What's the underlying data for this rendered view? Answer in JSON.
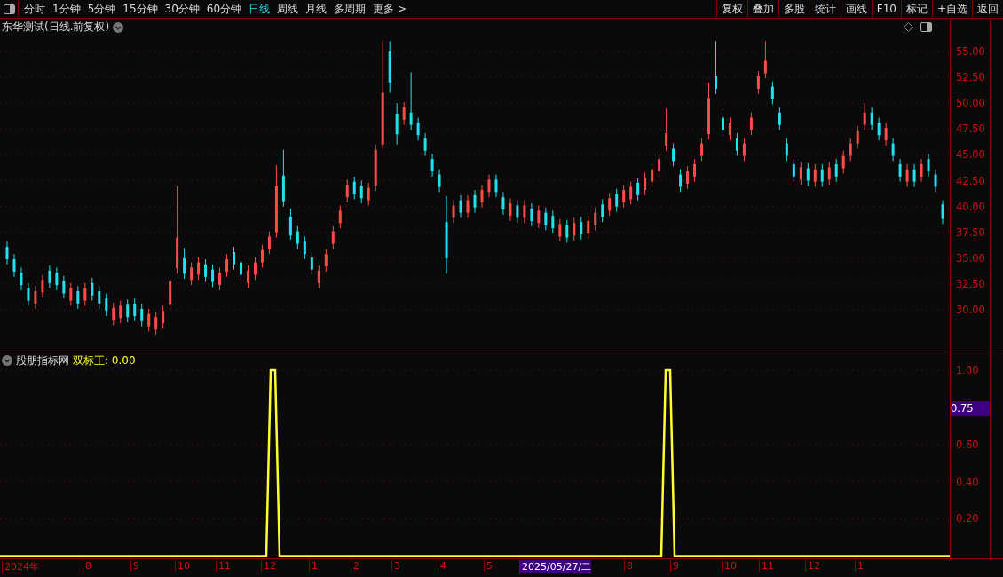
{
  "toolbar": {
    "periods": [
      {
        "label": "分时",
        "selected": false
      },
      {
        "label": "1分钟",
        "selected": false
      },
      {
        "label": "5分钟",
        "selected": false
      },
      {
        "label": "15分钟",
        "selected": false
      },
      {
        "label": "30分钟",
        "selected": false
      },
      {
        "label": "60分钟",
        "selected": false
      },
      {
        "label": "日线",
        "selected": true
      },
      {
        "label": "周线",
        "selected": false
      },
      {
        "label": "月线",
        "selected": false
      },
      {
        "label": "多周期",
        "selected": false
      },
      {
        "label": "更多 >",
        "selected": false
      }
    ],
    "actions": [
      "复权",
      "叠加",
      "多股",
      "统计",
      "画线",
      "F10",
      "标记",
      "+自选",
      "返回"
    ]
  },
  "chart": {
    "title": "东华测试(日线.前复权)",
    "chart_data": {
      "type": "candlestick",
      "grid": true,
      "ylim": [
        25.88,
        58.18
      ],
      "categories": [
        null,
        null,
        null,
        null,
        null,
        null,
        null,
        null,
        null,
        null,
        null,
        null,
        null,
        null,
        null,
        null,
        null,
        null,
        null,
        null,
        null,
        null,
        null,
        null,
        null,
        null,
        null,
        null,
        null,
        null,
        null,
        null,
        null,
        null,
        null,
        null,
        null,
        null,
        null,
        null,
        null,
        null,
        null,
        null,
        null,
        null,
        null,
        null,
        null,
        null,
        null,
        null,
        null,
        null,
        null,
        null,
        null,
        null,
        null,
        null,
        null,
        null,
        null,
        null,
        null,
        null,
        null,
        null,
        null,
        null,
        null,
        null,
        null,
        null,
        null,
        null,
        null,
        null,
        null,
        null,
        null,
        null,
        null,
        null,
        null,
        null,
        null,
        null,
        null,
        null,
        null,
        null,
        null,
        null,
        null,
        null,
        null,
        null,
        null,
        null,
        null,
        null,
        null,
        null,
        null,
        null,
        null,
        null,
        null,
        null,
        null,
        null,
        null,
        null,
        null,
        null,
        null,
        null,
        null,
        null,
        null,
        null,
        null,
        null,
        null,
        null,
        null,
        null,
        null,
        null,
        null,
        null,
        null
      ],
      "ohlc": [
        [
          36.1,
          36.6,
          34.4,
          34.9
        ],
        [
          34.9,
          35.4,
          33.2,
          33.7
        ],
        [
          33.6,
          34.1,
          31.9,
          32.4
        ],
        [
          32.1,
          32.6,
          30.4,
          30.9
        ],
        [
          30.6,
          32.3,
          30.1,
          31.8
        ],
        [
          31.7,
          33.4,
          31.2,
          32.9
        ],
        [
          33.8,
          34.3,
          32.1,
          32.6
        ],
        [
          33.6,
          34.1,
          31.9,
          32.4
        ],
        [
          32.8,
          33.3,
          31.1,
          31.6
        ],
        [
          30.9,
          32.6,
          30.4,
          32.1
        ],
        [
          31.8,
          32.3,
          30.1,
          30.6
        ],
        [
          30.9,
          32.6,
          30.4,
          32.1
        ],
        [
          32.6,
          33.1,
          30.9,
          31.4
        ],
        [
          31.8,
          32.3,
          30.1,
          30.6
        ],
        [
          31.1,
          31.6,
          29.4,
          29.9
        ],
        [
          29,
          30.7,
          28.5,
          30.2
        ],
        [
          29.2,
          30.9,
          28.7,
          30.4
        ],
        [
          30.5,
          31,
          28.8,
          29.3
        ],
        [
          30.6,
          31.1,
          28.9,
          29.4
        ],
        [
          30.1,
          30.6,
          28.4,
          28.9
        ],
        [
          28.4,
          30.1,
          27.9,
          29.6
        ],
        [
          28.1,
          29.8,
          27.6,
          29.3
        ],
        [
          28.7,
          30.4,
          28.2,
          29.9
        ],
        [
          30.5,
          33,
          30,
          32.8
        ],
        [
          34,
          42,
          33.5,
          37
        ],
        [
          35,
          36,
          33,
          33.5
        ],
        [
          32.9,
          34.6,
          32.4,
          34.1
        ],
        [
          33.4,
          35.1,
          32.9,
          34.6
        ],
        [
          34.4,
          34.9,
          32.7,
          33.2
        ],
        [
          33.9,
          34.4,
          32.2,
          32.7
        ],
        [
          32.4,
          34.1,
          31.9,
          33.6
        ],
        [
          33.7,
          35.4,
          33.2,
          34.9
        ],
        [
          35.6,
          36.1,
          33.9,
          34.4
        ],
        [
          34.6,
          35.1,
          32.9,
          33.4
        ],
        [
          32.6,
          34.3,
          32.1,
          33.8
        ],
        [
          33.4,
          35.1,
          32.9,
          34.6
        ],
        [
          34.6,
          36.3,
          34.1,
          35.8
        ],
        [
          35.9,
          37.6,
          35.4,
          37.1
        ],
        [
          37.5,
          44,
          37,
          42
        ],
        [
          43,
          45.5,
          40,
          40.5
        ],
        [
          39,
          39.8,
          36.8,
          37.2
        ],
        [
          37.6,
          38.1,
          35.9,
          36.4
        ],
        [
          36.6,
          37.1,
          34.9,
          35.4
        ],
        [
          35.1,
          35.6,
          33.4,
          33.9
        ],
        [
          32.6,
          34.3,
          32.1,
          33.8
        ],
        [
          34.2,
          35.9,
          33.7,
          35.4
        ],
        [
          36.4,
          38.1,
          35.9,
          37.6
        ],
        [
          38.4,
          40.1,
          37.9,
          39.6
        ],
        [
          40.9,
          42.6,
          40.4,
          42.1
        ],
        [
          42.4,
          42.9,
          40.7,
          41.2
        ],
        [
          42,
          42.5,
          40.3,
          40.8
        ],
        [
          40.6,
          42.3,
          40.1,
          41.8
        ],
        [
          42,
          46,
          41.5,
          45.5
        ],
        [
          46,
          56,
          45.5,
          51
        ],
        [
          55,
          56,
          51,
          52
        ],
        [
          49,
          50,
          46,
          47
        ],
        [
          48.4,
          50.1,
          47.9,
          49.6
        ],
        [
          49.1,
          53,
          47.4,
          47.9
        ],
        [
          48.1,
          48.6,
          46.4,
          46.9
        ],
        [
          46.6,
          47.1,
          44.9,
          45.4
        ],
        [
          44.6,
          45.1,
          42.9,
          43.4
        ],
        [
          43.1,
          43.6,
          41.4,
          41.9
        ],
        [
          38.5,
          41,
          33.5,
          35
        ],
        [
          38.9,
          40.6,
          38.4,
          40.1
        ],
        [
          40.6,
          41.1,
          38.9,
          39.4
        ],
        [
          39.4,
          41.1,
          38.9,
          40.6
        ],
        [
          41.1,
          41.6,
          39.4,
          39.9
        ],
        [
          40.4,
          42.1,
          39.9,
          41.6
        ],
        [
          41.4,
          43.1,
          40.9,
          42.6
        ],
        [
          42.6,
          43.1,
          40.9,
          41.4
        ],
        [
          40.9,
          41.4,
          39.2,
          39.7
        ],
        [
          39.1,
          40.8,
          38.6,
          40.3
        ],
        [
          40.1,
          40.6,
          38.4,
          38.9
        ],
        [
          38.9,
          40.6,
          38.4,
          40.1
        ],
        [
          39.8,
          40.3,
          38.1,
          38.6
        ],
        [
          38.4,
          40.1,
          37.9,
          39.6
        ],
        [
          39.4,
          39.9,
          37.7,
          38.2
        ],
        [
          39.1,
          39.6,
          37.4,
          37.9
        ],
        [
          37.1,
          38.8,
          36.6,
          38.3
        ],
        [
          38.2,
          38.7,
          36.5,
          37
        ],
        [
          37.2,
          38.9,
          36.7,
          38.4
        ],
        [
          38.5,
          39,
          36.8,
          37.3
        ],
        [
          37.4,
          39.1,
          36.9,
          38.6
        ],
        [
          38.2,
          39.9,
          37.7,
          39.4
        ],
        [
          40.2,
          40.7,
          38.5,
          39
        ],
        [
          39.6,
          41.3,
          39.1,
          40.8
        ],
        [
          41.2,
          41.7,
          39.5,
          40
        ],
        [
          40.4,
          42.1,
          39.9,
          41.6
        ],
        [
          40.7,
          42.4,
          40.2,
          41.9
        ],
        [
          42.3,
          42.8,
          40.6,
          41.1
        ],
        [
          41.6,
          43.3,
          41.1,
          42.8
        ],
        [
          42.4,
          44.1,
          41.9,
          43.6
        ],
        [
          43.4,
          45.1,
          42.9,
          44.6
        ],
        [
          45.9,
          49.5,
          45.4,
          47.1
        ],
        [
          45.6,
          46.1,
          43.9,
          44.4
        ],
        [
          43.1,
          43.6,
          41.4,
          41.9
        ],
        [
          42.2,
          43.9,
          41.7,
          43.4
        ],
        [
          42.9,
          44.6,
          42.4,
          44.1
        ],
        [
          44.9,
          46.6,
          44.4,
          46.1
        ],
        [
          47,
          52,
          46.5,
          50.5
        ],
        [
          52.6,
          56,
          50.9,
          51.4
        ],
        [
          48.6,
          49.1,
          46.9,
          47.4
        ],
        [
          46.9,
          48.6,
          46.4,
          48.1
        ],
        [
          46.6,
          47.1,
          44.9,
          45.4
        ],
        [
          44.9,
          46.6,
          44.4,
          46.1
        ],
        [
          47.4,
          49.1,
          46.9,
          48.6
        ],
        [
          51.4,
          53.1,
          50.9,
          52.6
        ],
        [
          52.9,
          56,
          52.4,
          54.1
        ],
        [
          51.6,
          52.1,
          49.9,
          50.4
        ],
        [
          49.1,
          49.6,
          47.4,
          47.9
        ],
        [
          46.1,
          46.6,
          44.4,
          44.9
        ],
        [
          44.1,
          44.6,
          42.4,
          42.9
        ],
        [
          42.6,
          44.3,
          42.1,
          43.8
        ],
        [
          43.7,
          44.2,
          42,
          42.5
        ],
        [
          42.4,
          44.1,
          41.9,
          43.6
        ],
        [
          43.6,
          44.1,
          41.9,
          42.4
        ],
        [
          42.6,
          44.3,
          42.1,
          43.8
        ],
        [
          44.1,
          44.6,
          42.4,
          42.9
        ],
        [
          43.7,
          45.4,
          43.2,
          44.9
        ],
        [
          44.9,
          46.6,
          44.4,
          46.1
        ],
        [
          46.1,
          47.8,
          45.6,
          47.3
        ],
        [
          47.9,
          50,
          47.4,
          49.1
        ],
        [
          49.1,
          49.6,
          47.4,
          47.9
        ],
        [
          48.1,
          48.6,
          46.4,
          46.9
        ],
        [
          46.4,
          48.1,
          45.9,
          47.6
        ],
        [
          46.1,
          46.6,
          44.4,
          44.9
        ],
        [
          44.1,
          44.6,
          42.4,
          42.9
        ],
        [
          42.4,
          44.1,
          41.9,
          43.6
        ],
        [
          43.6,
          44.1,
          41.9,
          42.4
        ],
        [
          42.9,
          44.6,
          42.4,
          44.1
        ],
        [
          44.6,
          45.1,
          42.9,
          43.4
        ],
        [
          43.1,
          43.6,
          41.4,
          41.9
        ],
        [
          40.2,
          40.6,
          38.3,
          38.8
        ]
      ],
      "yticks": [
        {
          "value": 55,
          "label": "55.00"
        },
        {
          "value": 52.5,
          "label": "52.50"
        },
        {
          "value": 50,
          "label": "50.00"
        },
        {
          "value": 47.5,
          "label": "47.50"
        },
        {
          "value": 45,
          "label": "45.00"
        },
        {
          "value": 42.5,
          "label": "42.50"
        },
        {
          "value": 40,
          "label": "40.00"
        },
        {
          "value": 37.5,
          "label": "37.50"
        },
        {
          "value": 35,
          "label": "35.00"
        },
        {
          "value": 32.5,
          "label": "32.50"
        },
        {
          "value": 30,
          "label": "30.00"
        }
      ]
    }
  },
  "indicator": {
    "source": "股朋指标网",
    "name": "双标王:",
    "value": "0.00",
    "cursor_value": "0.75",
    "chart_data": {
      "type": "line",
      "grid": true,
      "categories": [
        null,
        null,
        null,
        null,
        null,
        null,
        null,
        null,
        null,
        null,
        null,
        null,
        null,
        null,
        null,
        null,
        null,
        null,
        null,
        null,
        null,
        null,
        null,
        null,
        null,
        null,
        null,
        null,
        null,
        null,
        null,
        null,
        null,
        null,
        null,
        null,
        null,
        null,
        null,
        null,
        null,
        null,
        null,
        null,
        null,
        null,
        null,
        null,
        null,
        null,
        null,
        null,
        null,
        null,
        null,
        null,
        null,
        null,
        null,
        null,
        null,
        null,
        null,
        null,
        null,
        null,
        null,
        null,
        null,
        null,
        null,
        null,
        null,
        null,
        null,
        null,
        null,
        null,
        null,
        null,
        null,
        null,
        null,
        null,
        null,
        null,
        null,
        null,
        null,
        null,
        null,
        null,
        null,
        null,
        null,
        null,
        null,
        null,
        null,
        null,
        null,
        null,
        null,
        null,
        null,
        null,
        null,
        null,
        null,
        null,
        null,
        null,
        null,
        null,
        null,
        null,
        null,
        null,
        null,
        null,
        null,
        null,
        null,
        null,
        null,
        null,
        null,
        null,
        null,
        null,
        null,
        null,
        null,
        null,
        null,
        null,
        null,
        null,
        null,
        null,
        null,
        null,
        null,
        null,
        null,
        null,
        null,
        null,
        null,
        null,
        null,
        null,
        null,
        null,
        null,
        null,
        null,
        null,
        null,
        null,
        null,
        null,
        null,
        null,
        null,
        null,
        null,
        null,
        null,
        null,
        null,
        null,
        null,
        null,
        null,
        null,
        null,
        null,
        null,
        null,
        null,
        null,
        null,
        null,
        null,
        null,
        null,
        null,
        null,
        null,
        null,
        null,
        null,
        null,
        null,
        null,
        null,
        null,
        null,
        null,
        null,
        null,
        null,
        null,
        null,
        null,
        null,
        null,
        null,
        null,
        null,
        null,
        null,
        null,
        null
      ],
      "series": [
        {
          "color": "#ffff30",
          "values": [
            0,
            0,
            0,
            0,
            0,
            0,
            0,
            0,
            0,
            0,
            0,
            0,
            0,
            0,
            0,
            0,
            0,
            0,
            0,
            0,
            0,
            0,
            0,
            0,
            0,
            0,
            0,
            0,
            0,
            0,
            0,
            0,
            0,
            0,
            0,
            0,
            0,
            0,
            0,
            0,
            0,
            0,
            0,
            0,
            0,
            0,
            0,
            0,
            0,
            0,
            0,
            0,
            0,
            0,
            0,
            0,
            0,
            0,
            0,
            0,
            0,
            1,
            1,
            0,
            0,
            0,
            0,
            0,
            0,
            0,
            0,
            0,
            0,
            0,
            0,
            0,
            0,
            0,
            0,
            0,
            0,
            0,
            0,
            0,
            0,
            0,
            0,
            0,
            0,
            0,
            0,
            0,
            0,
            0,
            0,
            0,
            0,
            0,
            0,
            0,
            0,
            0,
            0,
            0,
            0,
            0,
            0,
            0,
            0,
            0,
            0,
            0,
            0,
            0,
            0,
            0,
            0,
            0,
            0,
            0,
            0,
            0,
            0,
            0,
            0,
            0,
            0,
            0,
            0,
            0,
            0,
            0,
            0,
            0,
            0,
            0,
            0,
            0,
            0,
            0,
            0,
            0,
            0,
            0,
            0,
            0,
            0,
            0,
            0,
            0,
            1,
            1,
            0,
            0,
            0,
            0,
            0,
            0,
            0,
            0,
            0,
            0,
            0,
            0,
            0,
            0,
            0,
            0,
            0,
            0,
            0,
            0,
            0,
            0,
            0,
            0,
            0,
            0,
            0,
            0,
            0,
            0,
            0,
            0,
            0,
            0,
            0,
            0,
            0,
            0,
            0,
            0,
            0,
            0,
            0,
            0,
            0,
            0,
            0,
            0,
            0,
            0,
            0,
            0,
            0,
            0,
            0,
            0,
            0,
            0,
            0,
            0,
            0,
            0,
            0
          ]
        }
      ],
      "ylim": [
        -0.017,
        1.096
      ],
      "yticks": [
        {
          "value": 1,
          "label": "1.00"
        },
        {
          "value": 0.6,
          "label": "0.60"
        },
        {
          "value": 0.4,
          "label": "0.40"
        },
        {
          "value": 0.2,
          "label": "0.20"
        }
      ]
    }
  },
  "date_axis": {
    "labels": [
      "2024年",
      "8",
      "9",
      "10",
      "11",
      "12",
      "1",
      "2",
      "3",
      "4",
      "5",
      "8",
      "9",
      "10",
      "11",
      "12",
      "1"
    ],
    "cursor_date": "2025/05/27/二"
  }
}
